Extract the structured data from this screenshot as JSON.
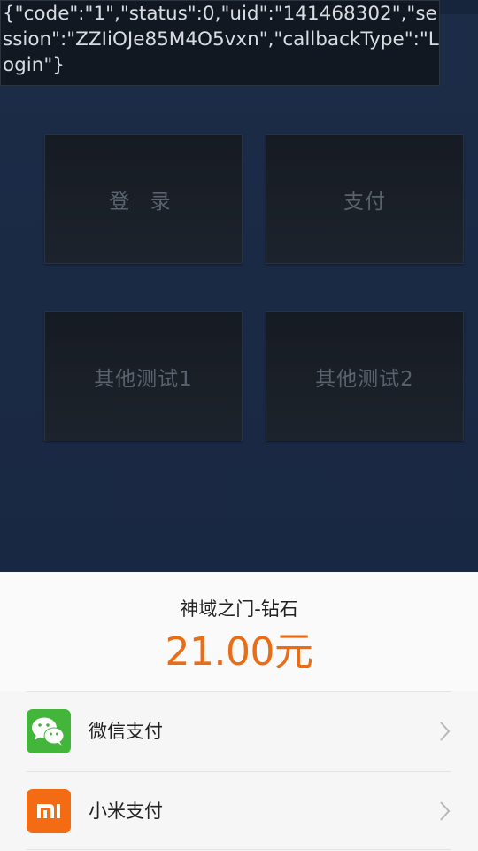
{
  "log": {
    "text": "{\"code\":\"1\",\"status\":0,\"uid\":\"141468302\",\"session\":\"ZZIiOJe85M4O5vxn\",\"callbackType\":\"Login\"}"
  },
  "buttons": {
    "login": "登 录",
    "pay": "支付",
    "test1": "其他测试1",
    "test2": "其他测试2"
  },
  "payment_sheet": {
    "product": "神域之门-钻石",
    "price": "21.00元",
    "methods": [
      {
        "label": "微信支付",
        "icon": "wechat-icon",
        "color": "#43b53a"
      },
      {
        "label": "小米支付",
        "icon": "mi-icon",
        "color": "#f36c14"
      }
    ]
  },
  "colors": {
    "background": "#1c2c47",
    "price": "#ea6c16"
  }
}
